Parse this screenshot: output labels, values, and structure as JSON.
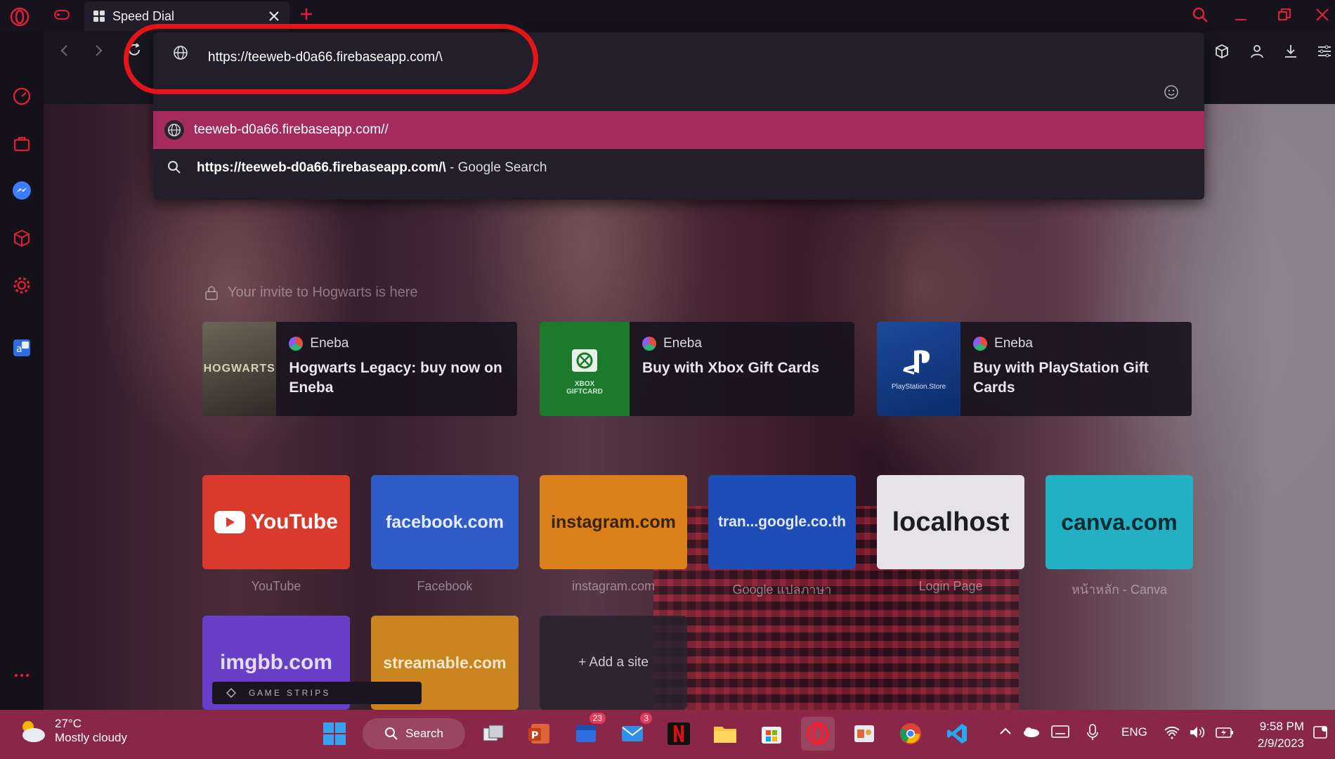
{
  "tab": {
    "title": "Speed Dial"
  },
  "address_bar": {
    "value": "https://teeweb-d0a66.firebaseapp.com/\\",
    "suggestions": [
      {
        "text": "teeweb-d0a66.firebaseapp.com//",
        "icon": "globe-icon"
      },
      {
        "query": "https://teeweb-d0a66.firebaseapp.com/\\",
        "suffix": " - Google Search",
        "icon": "search-icon"
      }
    ]
  },
  "invite_text": "Your invite to Hogwarts is here",
  "promos": [
    {
      "source": "Eneba",
      "title": "Hogwarts Legacy: buy now on Eneba",
      "thumb_text": "HOGWARTS"
    },
    {
      "source": "Eneba",
      "title": "Buy with Xbox Gift Cards",
      "thumb_text": "XBOX\nGIFTCARD"
    },
    {
      "source": "Eneba",
      "title": "Buy with PlayStation Gift Cards",
      "thumb_text": "PlayStation.Store"
    }
  ],
  "tiles": [
    {
      "label": "YouTube",
      "caption": "YouTube",
      "color": "#e23b2e"
    },
    {
      "label": "facebook.com",
      "caption": "Facebook",
      "color": "#2f5cc9"
    },
    {
      "label": "instagram.com",
      "caption": "instagram.com",
      "color": "#e3861a"
    },
    {
      "label": "tran...google.co.th",
      "caption": "Google แปลภาษา",
      "color": "#1f4db8"
    },
    {
      "label": "localhost",
      "caption": "Login Page",
      "color": "#e9e6ea"
    },
    {
      "label": "canva.com",
      "caption": "หน้าหลัก - Canva",
      "color": "#22b6c8"
    },
    {
      "label": "imgbb.com",
      "caption": "",
      "color": "#6a3fc8"
    },
    {
      "label": "streamable.com",
      "caption": "",
      "color": "#d9891a"
    },
    {
      "label": "+ Add a site",
      "caption": "",
      "color": "#2a2430"
    }
  ],
  "game_strips": "G A M E   S T R I P S",
  "taskbar": {
    "weather_temp": "27°C",
    "weather_desc": "Mostly cloudy",
    "search_label": "Search",
    "badge_teams": "23",
    "badge_mail": "3",
    "language": "ENG",
    "time": "9:58 PM",
    "date": "2/9/2023"
  }
}
